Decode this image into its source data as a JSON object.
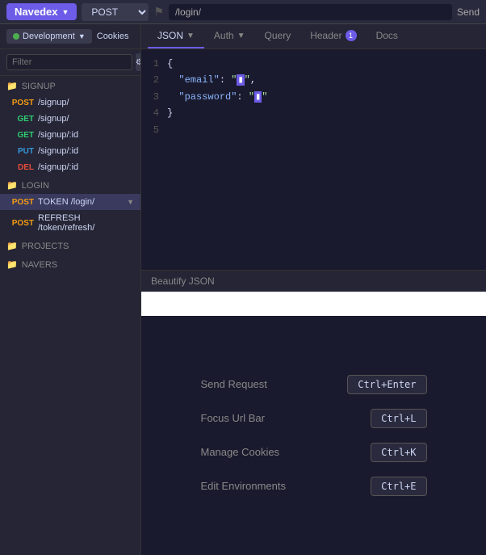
{
  "topbar": {
    "app_title": "Navedex",
    "method": "POST",
    "url": "/login/",
    "send_label": "Send"
  },
  "sidebar": {
    "env_label": "Development",
    "cookies_label": "Cookies",
    "filter_placeholder": "Filter",
    "sections": [
      {
        "name": "SIGNUP",
        "icon": "folder",
        "items": [
          {
            "method": "POST",
            "path": "/signup/"
          },
          {
            "method": "GET",
            "path": "/signup/"
          },
          {
            "method": "GET",
            "path": "/signup/:id"
          },
          {
            "method": "PUT",
            "path": "/signup/:id"
          },
          {
            "method": "DEL",
            "path": "/signup/:id"
          }
        ]
      },
      {
        "name": "LOGIN",
        "icon": "folder",
        "items": [
          {
            "method": "POST",
            "path": "TOKEN /login/",
            "active": true
          },
          {
            "method": "POST",
            "path": "REFRESH /token/refresh/"
          }
        ]
      },
      {
        "name": "PROJECTS",
        "icon": "folder",
        "items": []
      },
      {
        "name": "NAVERS",
        "icon": "folder",
        "items": []
      }
    ]
  },
  "tabs": [
    {
      "label": "JSON",
      "active": true,
      "badge": null
    },
    {
      "label": "Auth",
      "active": false,
      "badge": null
    },
    {
      "label": "Query",
      "active": false,
      "badge": null
    },
    {
      "label": "Header",
      "active": false,
      "badge": "1"
    },
    {
      "label": "Docs",
      "active": false,
      "badge": null
    }
  ],
  "editor": {
    "lines": [
      {
        "num": 1,
        "content": "{"
      },
      {
        "num": 2,
        "content": "  \"email\": \"▮\","
      },
      {
        "num": 3,
        "content": "  \"password\": \"▮\""
      },
      {
        "num": 4,
        "content": "}"
      },
      {
        "num": 5,
        "content": ""
      }
    ],
    "beautify_label": "Beautify JSON"
  },
  "shortcuts": [
    {
      "label": "Send Request",
      "key": "Ctrl+Enter"
    },
    {
      "label": "Focus Url Bar",
      "key": "Ctrl+L"
    },
    {
      "label": "Manage Cookies",
      "key": "Ctrl+K"
    },
    {
      "label": "Edit Environments",
      "key": "Ctrl+E"
    }
  ]
}
